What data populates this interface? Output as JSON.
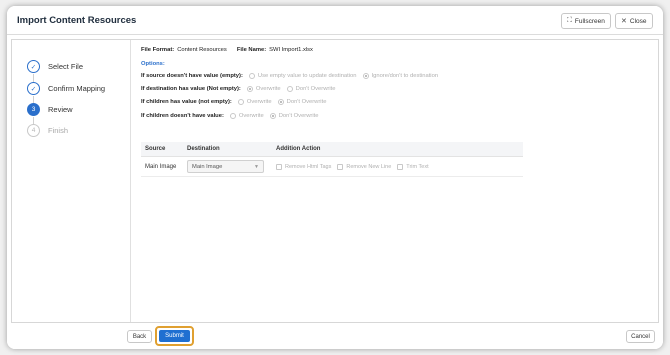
{
  "dialog": {
    "title": "Import Content Resources",
    "fullscreen_label": "Fullscreen",
    "close_label": "Close"
  },
  "steps": [
    {
      "label": "Select File",
      "state": "done",
      "marker": "✓"
    },
    {
      "label": "Confirm Mapping",
      "state": "done",
      "marker": "✓"
    },
    {
      "label": "Review",
      "state": "active",
      "marker": "3"
    },
    {
      "label": "Finish",
      "state": "pending",
      "marker": "4"
    }
  ],
  "review": {
    "file_format_label": "File Format:",
    "file_format_value": "Content Resources",
    "file_name_label": "File Name:",
    "file_name_value": "SWI Import1.xlsx",
    "options_label": "Options:",
    "options": [
      {
        "question": "If source doesn't have value (empty):",
        "choices": [
          "Use empty value to update destination",
          "Ignore/don't to destination"
        ],
        "selected": 1
      },
      {
        "question": "If destination has value (Not empty):",
        "choices": [
          "Overwrite",
          "Don't Overwrite"
        ],
        "selected": 0
      },
      {
        "question": "If children has value (not empty):",
        "choices": [
          "Overwrite",
          "Don't Overwrite"
        ],
        "selected": 1
      },
      {
        "question": "If children doesn't have value:",
        "choices": [
          "Overwrite",
          "Don't Overwrite"
        ],
        "selected": 1
      }
    ]
  },
  "table": {
    "headers": [
      "Source",
      "Destination",
      "Addition Action"
    ],
    "rows": [
      {
        "source": "Main Image",
        "destination": "Main Image",
        "actions": [
          "Remove Html Tags",
          "Remove New Line",
          "Trim Text"
        ]
      }
    ]
  },
  "footer": {
    "back_label": "Back",
    "submit_label": "Submit",
    "cancel_label": "Cancel"
  },
  "colors": {
    "accent": "#1f6fd1",
    "highlight": "#e0a030"
  }
}
